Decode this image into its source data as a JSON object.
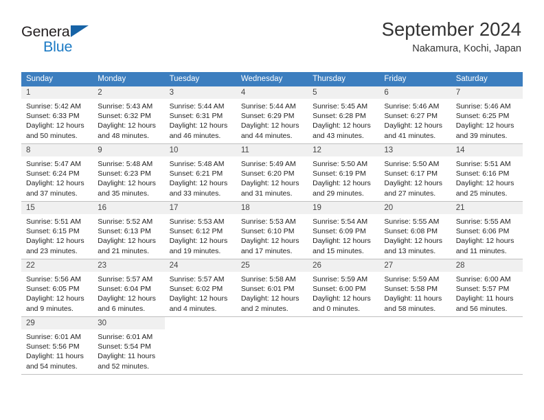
{
  "brand": {
    "name_top": "General",
    "name_bottom": "Blue",
    "triangle_color": "#1763a6",
    "blue_color": "#1b7ac4"
  },
  "header": {
    "title": "September 2024",
    "subtitle": "Nakamura, Kochi, Japan"
  },
  "theme": {
    "header_bg": "#3c7ebf",
    "header_text": "#ffffff",
    "daynum_bg": "#f0f0f0",
    "grid_line": "#bfbfbf"
  },
  "weekdays": [
    "Sunday",
    "Monday",
    "Tuesday",
    "Wednesday",
    "Thursday",
    "Friday",
    "Saturday"
  ],
  "weeks": [
    [
      {
        "day": "1",
        "l1": "Sunrise: 5:42 AM",
        "l2": "Sunset: 6:33 PM",
        "l3": "Daylight: 12 hours",
        "l4": "and 50 minutes."
      },
      {
        "day": "2",
        "l1": "Sunrise: 5:43 AM",
        "l2": "Sunset: 6:32 PM",
        "l3": "Daylight: 12 hours",
        "l4": "and 48 minutes."
      },
      {
        "day": "3",
        "l1": "Sunrise: 5:44 AM",
        "l2": "Sunset: 6:31 PM",
        "l3": "Daylight: 12 hours",
        "l4": "and 46 minutes."
      },
      {
        "day": "4",
        "l1": "Sunrise: 5:44 AM",
        "l2": "Sunset: 6:29 PM",
        "l3": "Daylight: 12 hours",
        "l4": "and 44 minutes."
      },
      {
        "day": "5",
        "l1": "Sunrise: 5:45 AM",
        "l2": "Sunset: 6:28 PM",
        "l3": "Daylight: 12 hours",
        "l4": "and 43 minutes."
      },
      {
        "day": "6",
        "l1": "Sunrise: 5:46 AM",
        "l2": "Sunset: 6:27 PM",
        "l3": "Daylight: 12 hours",
        "l4": "and 41 minutes."
      },
      {
        "day": "7",
        "l1": "Sunrise: 5:46 AM",
        "l2": "Sunset: 6:25 PM",
        "l3": "Daylight: 12 hours",
        "l4": "and 39 minutes."
      }
    ],
    [
      {
        "day": "8",
        "l1": "Sunrise: 5:47 AM",
        "l2": "Sunset: 6:24 PM",
        "l3": "Daylight: 12 hours",
        "l4": "and 37 minutes."
      },
      {
        "day": "9",
        "l1": "Sunrise: 5:48 AM",
        "l2": "Sunset: 6:23 PM",
        "l3": "Daylight: 12 hours",
        "l4": "and 35 minutes."
      },
      {
        "day": "10",
        "l1": "Sunrise: 5:48 AM",
        "l2": "Sunset: 6:21 PM",
        "l3": "Daylight: 12 hours",
        "l4": "and 33 minutes."
      },
      {
        "day": "11",
        "l1": "Sunrise: 5:49 AM",
        "l2": "Sunset: 6:20 PM",
        "l3": "Daylight: 12 hours",
        "l4": "and 31 minutes."
      },
      {
        "day": "12",
        "l1": "Sunrise: 5:50 AM",
        "l2": "Sunset: 6:19 PM",
        "l3": "Daylight: 12 hours",
        "l4": "and 29 minutes."
      },
      {
        "day": "13",
        "l1": "Sunrise: 5:50 AM",
        "l2": "Sunset: 6:17 PM",
        "l3": "Daylight: 12 hours",
        "l4": "and 27 minutes."
      },
      {
        "day": "14",
        "l1": "Sunrise: 5:51 AM",
        "l2": "Sunset: 6:16 PM",
        "l3": "Daylight: 12 hours",
        "l4": "and 25 minutes."
      }
    ],
    [
      {
        "day": "15",
        "l1": "Sunrise: 5:51 AM",
        "l2": "Sunset: 6:15 PM",
        "l3": "Daylight: 12 hours",
        "l4": "and 23 minutes."
      },
      {
        "day": "16",
        "l1": "Sunrise: 5:52 AM",
        "l2": "Sunset: 6:13 PM",
        "l3": "Daylight: 12 hours",
        "l4": "and 21 minutes."
      },
      {
        "day": "17",
        "l1": "Sunrise: 5:53 AM",
        "l2": "Sunset: 6:12 PM",
        "l3": "Daylight: 12 hours",
        "l4": "and 19 minutes."
      },
      {
        "day": "18",
        "l1": "Sunrise: 5:53 AM",
        "l2": "Sunset: 6:10 PM",
        "l3": "Daylight: 12 hours",
        "l4": "and 17 minutes."
      },
      {
        "day": "19",
        "l1": "Sunrise: 5:54 AM",
        "l2": "Sunset: 6:09 PM",
        "l3": "Daylight: 12 hours",
        "l4": "and 15 minutes."
      },
      {
        "day": "20",
        "l1": "Sunrise: 5:55 AM",
        "l2": "Sunset: 6:08 PM",
        "l3": "Daylight: 12 hours",
        "l4": "and 13 minutes."
      },
      {
        "day": "21",
        "l1": "Sunrise: 5:55 AM",
        "l2": "Sunset: 6:06 PM",
        "l3": "Daylight: 12 hours",
        "l4": "and 11 minutes."
      }
    ],
    [
      {
        "day": "22",
        "l1": "Sunrise: 5:56 AM",
        "l2": "Sunset: 6:05 PM",
        "l3": "Daylight: 12 hours",
        "l4": "and 9 minutes."
      },
      {
        "day": "23",
        "l1": "Sunrise: 5:57 AM",
        "l2": "Sunset: 6:04 PM",
        "l3": "Daylight: 12 hours",
        "l4": "and 6 minutes."
      },
      {
        "day": "24",
        "l1": "Sunrise: 5:57 AM",
        "l2": "Sunset: 6:02 PM",
        "l3": "Daylight: 12 hours",
        "l4": "and 4 minutes."
      },
      {
        "day": "25",
        "l1": "Sunrise: 5:58 AM",
        "l2": "Sunset: 6:01 PM",
        "l3": "Daylight: 12 hours",
        "l4": "and 2 minutes."
      },
      {
        "day": "26",
        "l1": "Sunrise: 5:59 AM",
        "l2": "Sunset: 6:00 PM",
        "l3": "Daylight: 12 hours",
        "l4": "and 0 minutes."
      },
      {
        "day": "27",
        "l1": "Sunrise: 5:59 AM",
        "l2": "Sunset: 5:58 PM",
        "l3": "Daylight: 11 hours",
        "l4": "and 58 minutes."
      },
      {
        "day": "28",
        "l1": "Sunrise: 6:00 AM",
        "l2": "Sunset: 5:57 PM",
        "l3": "Daylight: 11 hours",
        "l4": "and 56 minutes."
      }
    ],
    [
      {
        "day": "29",
        "l1": "Sunrise: 6:01 AM",
        "l2": "Sunset: 5:56 PM",
        "l3": "Daylight: 11 hours",
        "l4": "and 54 minutes."
      },
      {
        "day": "30",
        "l1": "Sunrise: 6:01 AM",
        "l2": "Sunset: 5:54 PM",
        "l3": "Daylight: 11 hours",
        "l4": "and 52 minutes."
      },
      {
        "day": "",
        "l1": "",
        "l2": "",
        "l3": "",
        "l4": ""
      },
      {
        "day": "",
        "l1": "",
        "l2": "",
        "l3": "",
        "l4": ""
      },
      {
        "day": "",
        "l1": "",
        "l2": "",
        "l3": "",
        "l4": ""
      },
      {
        "day": "",
        "l1": "",
        "l2": "",
        "l3": "",
        "l4": ""
      },
      {
        "day": "",
        "l1": "",
        "l2": "",
        "l3": "",
        "l4": ""
      }
    ]
  ]
}
